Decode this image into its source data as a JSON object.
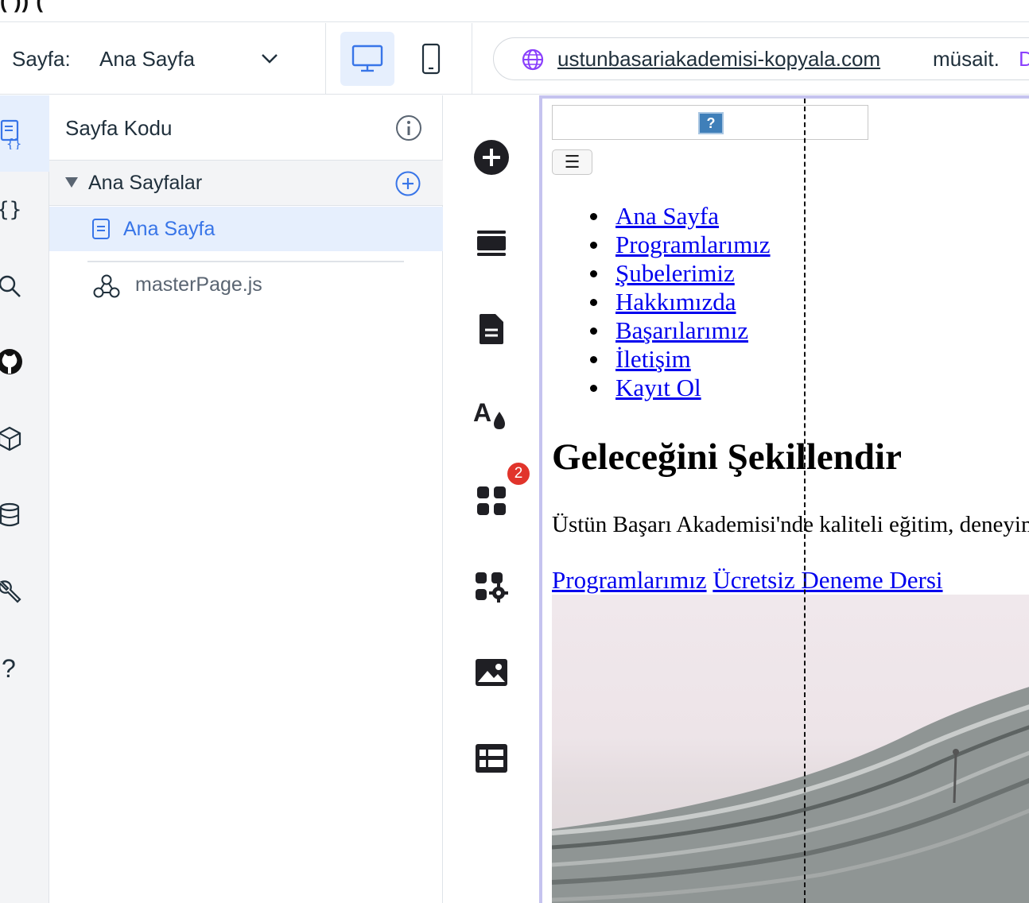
{
  "top_strip": {
    "cut_text": "( )) ("
  },
  "toolbar": {
    "page_label": "Sayfa:",
    "page_value": "Ana Sayfa",
    "url_domain": "ustunbasariakademisi-kopyala.com",
    "url_status": "müsait.",
    "url_more": "D"
  },
  "code_panel": {
    "title": "Sayfa Kodu",
    "section_label": "Ana Sayfalar",
    "active_file": "Ana Sayfa",
    "master_file": "masterPage.js"
  },
  "add_bar": {
    "apps_badge": "2"
  },
  "site": {
    "nav": [
      "Ana Sayfa",
      "Programlarımız",
      "Şubelerimiz",
      "Hakkımızda",
      "Başarılarımız",
      "İletişim",
      "Kayıt Ol"
    ],
    "hero_title": "Geleceğini Şekillendir",
    "hero_text": "Üstün Başarı Akademisi'nde kaliteli eğitim, deneyimli",
    "link_programs": "Programlarımız",
    "link_trial": "Ücretsiz Deneme Dersi",
    "menu_glyph": "☰",
    "broken_image_glyph": "?"
  },
  "colors": {
    "accent": "#3875e8",
    "selection": "#e6effd",
    "canvas_border": "#c5c3ef",
    "badge": "#e1342b",
    "link": "#0000ee"
  }
}
